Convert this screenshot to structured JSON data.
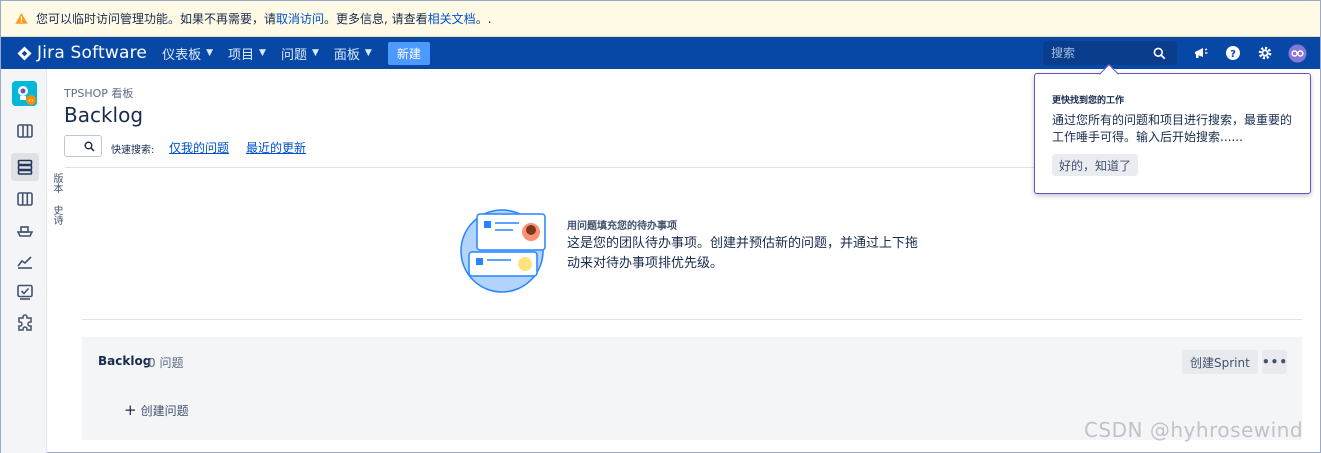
{
  "banner": {
    "text_before": "您可以临时访问管理功能。如果不再需要，请 ",
    "link_revoke": "取消访问",
    "text_middle": "。更多信息, 请查看 ",
    "link_docs": "相关文档",
    "text_after": "。."
  },
  "nav": {
    "logo_text": "Jira Software",
    "items": [
      "仪表板",
      "项目",
      "问题",
      "面板"
    ],
    "create_label": "新建",
    "search_placeholder": "搜索"
  },
  "sidebar": {
    "icons": [
      "project-avatar",
      "board-icon",
      "backlog-icon",
      "columns-icon",
      "ship-icon",
      "reports-icon",
      "issues-icon",
      "addons-icon"
    ]
  },
  "vtabs": [
    "版本",
    "史诗"
  ],
  "main": {
    "breadcrumb": "TPSHOP 看板",
    "title": "Backlog",
    "quick_search_label": "快速搜索:",
    "quick_links": [
      "仅我的问题",
      "最近的更新"
    ]
  },
  "empty": {
    "heading": "用问题填充您的待办事项",
    "text": "这是您的团队待办事项。创建并预估新的问题，并通过上下拖动来对待办事项排优先级。"
  },
  "backlog": {
    "title": "Backlog",
    "count": "0 问题",
    "create_sprint": "创建Sprint",
    "more": "•••",
    "create_issue": "创建问题"
  },
  "popup": {
    "title": "更快找到您的工作",
    "body": "通过您所有的问题和项目进行搜索，最重要的工作唾手可得。输入后开始搜索......",
    "button": "好的，知道了"
  },
  "watermark": "CSDN @hyhrosewind"
}
